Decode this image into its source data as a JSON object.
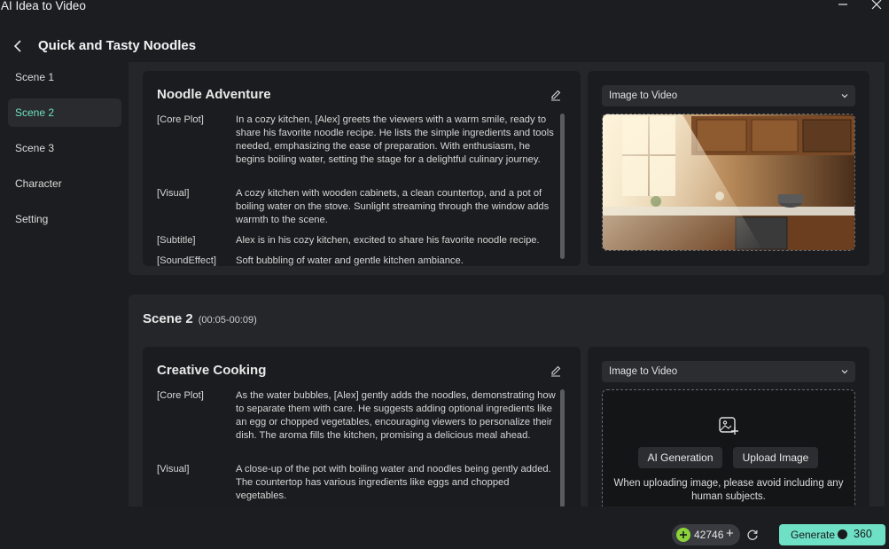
{
  "window": {
    "title": "AI Idea to Video",
    "minimize_icon": "minimize-icon",
    "close_icon": "close-icon"
  },
  "header": {
    "title": "Quick and Tasty Noodles"
  },
  "sidebar": {
    "items": [
      {
        "label": "Scene 1",
        "active": false
      },
      {
        "label": "Scene 2",
        "active": true
      },
      {
        "label": "Scene 3",
        "active": false
      },
      {
        "label": "Character",
        "active": false
      },
      {
        "label": "Setting",
        "active": false
      }
    ]
  },
  "scene1": {
    "card_title": "Noodle Adventure",
    "fields": [
      {
        "label": "[Core Plot]",
        "text": "In a cozy kitchen, [Alex] greets the viewers with a warm smile, ready to share his favorite noodle recipe. He lists the simple ingredients and tools needed, emphasizing the ease of preparation. With enthusiasm, he begins boiling water, setting the stage for a delightful culinary journey."
      },
      {
        "label": "[Visual]",
        "text": "A cozy kitchen with wooden cabinets, a clean countertop, and a pot of boiling water on the stove. Sunlight streaming through the window adds warmth to the scene."
      },
      {
        "label": "[Subtitle]",
        "text": "Alex is in his cozy kitchen, excited to share his favorite noodle recipe."
      },
      {
        "label": "[SoundEffect]",
        "text": "Soft bubbling of water and gentle kitchen ambiance."
      }
    ],
    "mode": "Image to Video"
  },
  "scene2": {
    "heading": "Scene 2",
    "time": "(00:05-00:09)",
    "card_title": "Creative Cooking",
    "fields": [
      {
        "label": "[Core Plot]",
        "text": "As the water bubbles, [Alex] gently adds the noodles, demonstrating how to separate them with care. He suggests adding optional ingredients like an egg or chopped vegetables, encouraging viewers to personalize their dish. The aroma fills the kitchen, promising a delicious meal ahead."
      },
      {
        "label": "[Visual]",
        "text": "A close-up of the pot with boiling water and noodles being gently added. The countertop has various ingredients like eggs and chopped vegetables."
      }
    ],
    "mode": "Image to Video",
    "ai_generation_label": "AI Generation",
    "upload_image_label": "Upload Image",
    "upload_note": "When uploading image, please avoid including any human subjects."
  },
  "footer": {
    "credits": "42746",
    "generate_label": "Generate",
    "generate_cost": "360"
  },
  "colors": {
    "accent": "#6ee0c6",
    "credit_icon": "#8ad43a"
  }
}
